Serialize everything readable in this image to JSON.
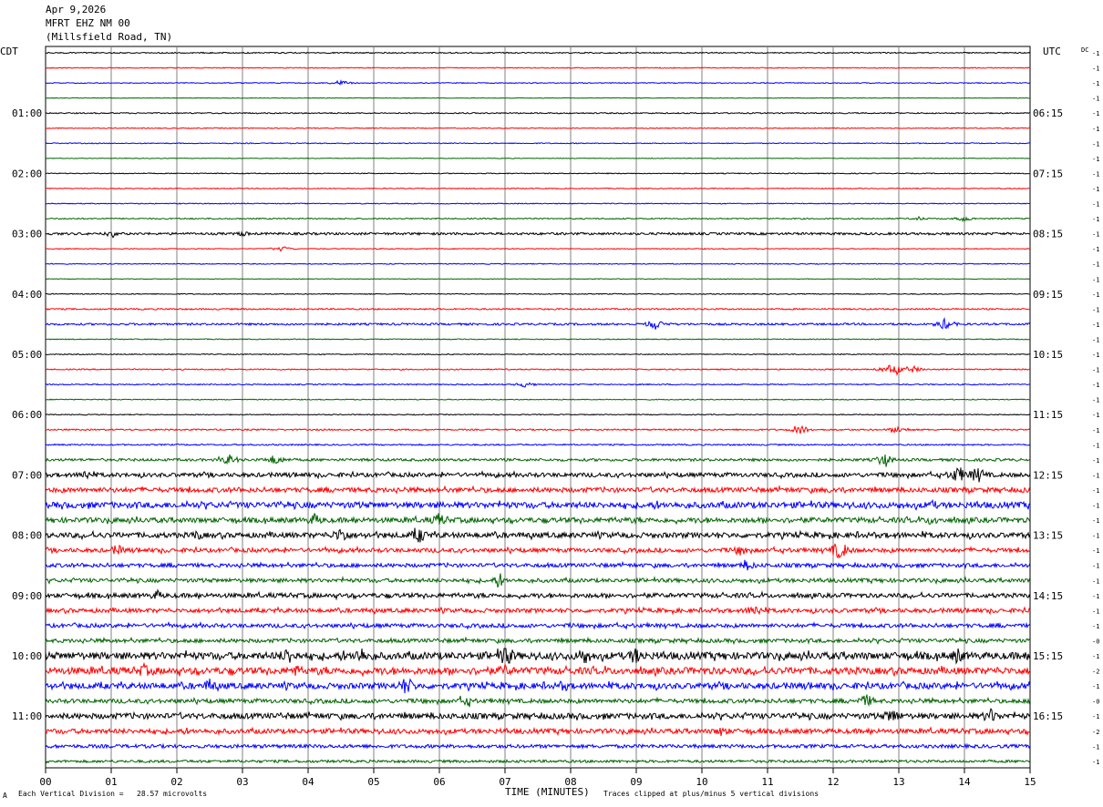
{
  "header": {
    "date": "Apr 9,2026",
    "station": "MFRT EHZ NM 00",
    "location": "(Millsfield Road, TN)"
  },
  "left_tz": "CDT",
  "right_tz": "UTC",
  "dc_label": "DC",
  "footer": {
    "scale_note": "Each Vertical Division =   28.57 microvolts",
    "clip_note": "Traces clipped at plus/minus 5 vertical divisions",
    "mark": "A"
  },
  "colors": {
    "black": "#000000",
    "red": "#ff0000",
    "blue": "#0000ff",
    "green": "#006400",
    "grid": "#808080"
  },
  "chart_data": {
    "type": "line",
    "xlabel": "TIME (MINUTES)",
    "x_ticks": [
      "00",
      "01",
      "02",
      "03",
      "04",
      "05",
      "06",
      "07",
      "08",
      "09",
      "10",
      "11",
      "12",
      "13",
      "14",
      "15"
    ],
    "xlim": [
      0,
      15
    ],
    "row_minutes": 15,
    "trace_colors": [
      "black",
      "red",
      "blue",
      "green"
    ],
    "left_hour_labels": [
      "01:00",
      "02:00",
      "03:00",
      "04:00",
      "05:00",
      "06:00",
      "07:00",
      "08:00",
      "09:00",
      "10:00",
      "11:00"
    ],
    "right_hour_labels": [
      "06:15",
      "07:15",
      "08:15",
      "09:15",
      "10:15",
      "11:15",
      "12:15",
      "13:15",
      "14:15",
      "15:15",
      "16:15"
    ],
    "dc_offsets": [
      "-1",
      "-1",
      "-1",
      "-1",
      "-1",
      "-1",
      "-1",
      "-1",
      "-1",
      "-1",
      "-1",
      "-1",
      "-1",
      "-1",
      "-1",
      "-1",
      "-1",
      "-1",
      "-1",
      "-1",
      "-1",
      "-1",
      "-1",
      "-1",
      "-1",
      "-1",
      "-1",
      "-1",
      "-1",
      "-1",
      "-1",
      "-1",
      "-1",
      "-1",
      "-1",
      "-1",
      "-1",
      "-1",
      "-1",
      "-0",
      "-1",
      "-2",
      "-1",
      "-0",
      "-1",
      "-2",
      "-1",
      "-1",
      "-0",
      "-1",
      "-0",
      "-1",
      "-1",
      "-1",
      "-1",
      "-1",
      "-1"
    ],
    "row_activity": [
      0.4,
      0.3,
      0.3,
      0.2,
      0.4,
      0.3,
      0.3,
      0.2,
      0.3,
      0.3,
      0.3,
      0.4,
      0.8,
      0.3,
      0.3,
      0.2,
      0.3,
      0.5,
      0.7,
      0.3,
      0.3,
      0.4,
      0.4,
      0.3,
      0.3,
      0.5,
      0.5,
      0.9,
      1.4,
      1.6,
      2.0,
      1.7,
      1.8,
      1.4,
      1.3,
      1.3,
      1.5,
      1.4,
      1.3,
      1.3,
      2.4,
      2.3,
      2.0,
      1.4,
      1.9,
      1.6,
      1.2,
      0.9
    ],
    "events": [
      {
        "row": 2,
        "min": 4.5,
        "amp": 2
      },
      {
        "row": 11,
        "min": 13.3,
        "amp": 1.5
      },
      {
        "row": 11,
        "min": 14.0,
        "amp": 2
      },
      {
        "row": 12,
        "min": 1.0,
        "amp": 2
      },
      {
        "row": 12,
        "min": 3.0,
        "amp": 2
      },
      {
        "row": 13,
        "min": 3.6,
        "amp": 2
      },
      {
        "row": 18,
        "min": 9.3,
        "amp": 4
      },
      {
        "row": 18,
        "min": 13.7,
        "amp": 4
      },
      {
        "row": 21,
        "min": 12.9,
        "amp": 4
      },
      {
        "row": 21,
        "min": 13.2,
        "amp": 2.5
      },
      {
        "row": 22,
        "min": 7.3,
        "amp": 2
      },
      {
        "row": 25,
        "min": 11.5,
        "amp": 3
      },
      {
        "row": 25,
        "min": 13.0,
        "amp": 3
      },
      {
        "row": 27,
        "min": 2.8,
        "amp": 4
      },
      {
        "row": 27,
        "min": 3.5,
        "amp": 4
      },
      {
        "row": 27,
        "min": 12.8,
        "amp": 4
      },
      {
        "row": 28,
        "min": 0.6,
        "amp": 4
      },
      {
        "row": 28,
        "min": 13.9,
        "amp": 6
      },
      {
        "row": 28,
        "min": 14.2,
        "amp": 6
      },
      {
        "row": 29,
        "min": 12.0,
        "amp": 3
      },
      {
        "row": 30,
        "min": 13.5,
        "amp": 4
      },
      {
        "row": 31,
        "min": 4.1,
        "amp": 5
      },
      {
        "row": 31,
        "min": 6.0,
        "amp": 5
      },
      {
        "row": 31,
        "min": 13.5,
        "amp": 4
      },
      {
        "row": 32,
        "min": 2.3,
        "amp": 4
      },
      {
        "row": 32,
        "min": 4.5,
        "amp": 6
      },
      {
        "row": 32,
        "min": 5.7,
        "amp": 6
      },
      {
        "row": 33,
        "min": 1.1,
        "amp": 4
      },
      {
        "row": 33,
        "min": 10.6,
        "amp": 4
      },
      {
        "row": 33,
        "min": 12.1,
        "amp": 7
      },
      {
        "row": 34,
        "min": 10.7,
        "amp": 4
      },
      {
        "row": 35,
        "min": 6.9,
        "amp": 4
      },
      {
        "row": 36,
        "min": 1.7,
        "amp": 4
      },
      {
        "row": 37,
        "min": 10.8,
        "amp": 5
      },
      {
        "row": 40,
        "min": 3.7,
        "amp": 7
      },
      {
        "row": 40,
        "min": 4.8,
        "amp": 7
      },
      {
        "row": 40,
        "min": 7.0,
        "amp": 9
      },
      {
        "row": 40,
        "min": 8.2,
        "amp": 7
      },
      {
        "row": 40,
        "min": 9.0,
        "amp": 7
      },
      {
        "row": 40,
        "min": 13.9,
        "amp": 6
      },
      {
        "row": 41,
        "min": 1.5,
        "amp": 5
      },
      {
        "row": 41,
        "min": 3.8,
        "amp": 5
      },
      {
        "row": 41,
        "min": 7.0,
        "amp": 5
      },
      {
        "row": 42,
        "min": 2.5,
        "amp": 5
      },
      {
        "row": 42,
        "min": 5.5,
        "amp": 7
      },
      {
        "row": 42,
        "min": 7.9,
        "amp": 4
      },
      {
        "row": 43,
        "min": 6.4,
        "amp": 4
      },
      {
        "row": 43,
        "min": 12.5,
        "amp": 5
      },
      {
        "row": 44,
        "min": 12.9,
        "amp": 6
      },
      {
        "row": 44,
        "min": 14.4,
        "amp": 6
      },
      {
        "row": 45,
        "min": 10.3,
        "amp": 4
      }
    ]
  }
}
